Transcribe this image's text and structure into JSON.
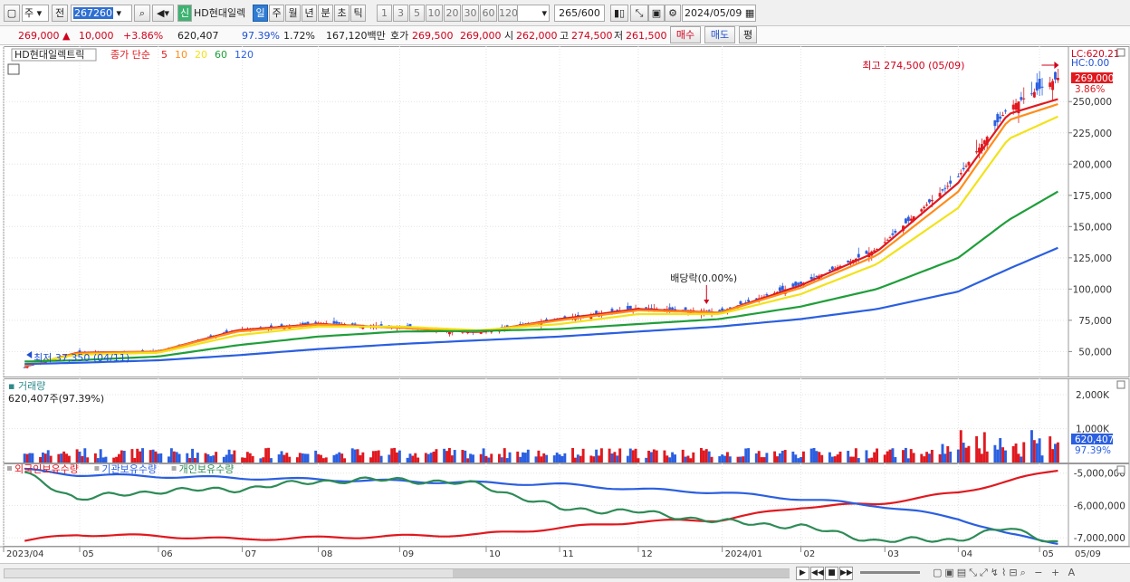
{
  "toolbar": {
    "market": "주",
    "prev_label": "전",
    "code": "267260",
    "badge": "신",
    "name": "HD현대일렉",
    "periods": [
      "일",
      "주",
      "월",
      "년",
      "분",
      "초",
      "틱"
    ],
    "active_period": "일",
    "intervals": [
      "1",
      "3",
      "5",
      "10",
      "20",
      "30",
      "60",
      "120"
    ],
    "count": "265",
    "count_total": "/600",
    "date": "2024/05/09"
  },
  "info": {
    "price": "269,000",
    "change": "10,000",
    "change_pct": "+3.86%",
    "volume": "620,407",
    "vol_ratio": "97.39%",
    "turnover": "1.72%",
    "trade_value": "167,120백만",
    "quote_label": "호가",
    "bid": "269,500",
    "ask": "269,000",
    "open_label": "시",
    "open": "262,000",
    "high_label": "고",
    "high": "274,500",
    "low_label": "저",
    "low": "261,500",
    "buy_label": "매수",
    "sell_label": "매도",
    "eval_label": "평"
  },
  "panels": {
    "price": {
      "name_label": "HD현대일렉트릭",
      "ma_label": "종가 단순",
      "ma_periods": [
        "5",
        "10",
        "20",
        "60",
        "120"
      ],
      "ma_colors": [
        "#e0191f",
        "#ff8c1a",
        "#f2e21a",
        "#1f9e3a",
        "#2b5fe0"
      ],
      "high_marker": "최고 274,500 (05/09)",
      "low_marker": "최저 37,350 (04/11)",
      "event_marker": "배당락(0.00%)",
      "lc_label": "LC:620.21",
      "hc_label": "HC:0.00",
      "last_price_tag": "269,000",
      "last_pct_tag": "3.86%"
    },
    "volume": {
      "title": "거래량",
      "subtitle": "620,407주(97.39%)",
      "last_tag": "620,407",
      "last_pct_tag": "97.39%"
    },
    "holdings": {
      "legend": [
        "외국인보유수량",
        "기관보유수량",
        "개인보유수량"
      ],
      "colors": [
        "#e0191f",
        "#2b5fe0",
        "#2e8b57"
      ]
    }
  },
  "chart_data": [
    {
      "type": "candlestick",
      "title": "HD현대일렉트릭",
      "x_ticks": [
        "2023/04",
        "05",
        "06",
        "07",
        "08",
        "09",
        "10",
        "11",
        "12",
        "2024/01",
        "02",
        "03",
        "04",
        "05",
        "05/09"
      ],
      "yticks": [
        50000,
        75000,
        100000,
        125000,
        150000,
        175000,
        200000,
        225000,
        250000
      ],
      "ylim": [
        30000,
        290000
      ],
      "series": [
        {
          "name": "종가",
          "x": [
            "2023-04-11",
            "2023-05-01",
            "2023-06-01",
            "2023-07-01",
            "2023-08-01",
            "2023-09-01",
            "2023-10-01",
            "2023-11-01",
            "2023-12-01",
            "2024-01-01",
            "2024-02-01",
            "2024-03-01",
            "2024-04-01",
            "2024-04-20",
            "2024-05-09"
          ],
          "values": [
            37350,
            49000,
            50000,
            67000,
            73000,
            70000,
            65000,
            76000,
            85000,
            82000,
            104000,
            132000,
            190000,
            245000,
            269000
          ]
        },
        {
          "name": "5",
          "values": [
            38000,
            49000,
            50000,
            67000,
            72000,
            69000,
            65500,
            76000,
            84000,
            81000,
            103000,
            130000,
            185000,
            240000,
            252000
          ]
        },
        {
          "name": "10",
          "values": [
            38500,
            48500,
            50000,
            66000,
            71500,
            69000,
            66000,
            75000,
            83000,
            81000,
            101000,
            127000,
            178000,
            235000,
            248000
          ]
        },
        {
          "name": "20",
          "values": [
            40000,
            47500,
            49000,
            63000,
            70000,
            70000,
            67000,
            72000,
            80000,
            80000,
            96000,
            120000,
            165000,
            220000,
            238000
          ]
        },
        {
          "name": "60",
          "values": [
            42000,
            43000,
            46000,
            55000,
            62000,
            66000,
            66500,
            68000,
            72000,
            76000,
            86000,
            100000,
            125000,
            155000,
            178000
          ]
        },
        {
          "name": "120",
          "values": [
            40000,
            41000,
            43000,
            47000,
            52000,
            56000,
            59000,
            62000,
            66000,
            70000,
            76000,
            84000,
            98000,
            116000,
            133000
          ]
        }
      ],
      "high": {
        "value": 274500,
        "date": "05/09"
      },
      "low": {
        "value": 37350,
        "date": "04/11"
      }
    },
    {
      "type": "bar",
      "title": "거래량",
      "yticks": [
        "1,000K",
        "2,000K"
      ],
      "last": 620407
    },
    {
      "type": "line",
      "title": "보유수량",
      "yticks": [
        "-5,000,000",
        "-6,000,000",
        "-7,000,000"
      ],
      "series": [
        {
          "name": "외국인보유수량",
          "values": [
            -7100000,
            -6900000,
            -6950000,
            -7050000,
            -7000000,
            -6950000,
            -6900000,
            -6700000,
            -6500000,
            -6450000,
            -6050000,
            -5950000,
            -5600000,
            -5250000,
            -4900000
          ]
        },
        {
          "name": "기관보유수량",
          "values": [
            -4900000,
            -5050000,
            -5100000,
            -5150000,
            -5200000,
            -5250000,
            -5300000,
            -5350000,
            -5500000,
            -5600000,
            -5800000,
            -6000000,
            -6400000,
            -6900000,
            -7150000
          ]
        },
        {
          "name": "개인보유수량",
          "values": [
            -5000000,
            -5800000,
            -5550000,
            -5500000,
            -5250000,
            -5200000,
            -5350000,
            -6100000,
            -6200000,
            -6500000,
            -6650000,
            -7100000,
            -7050000,
            -6700000,
            -7150000
          ]
        }
      ]
    }
  ]
}
